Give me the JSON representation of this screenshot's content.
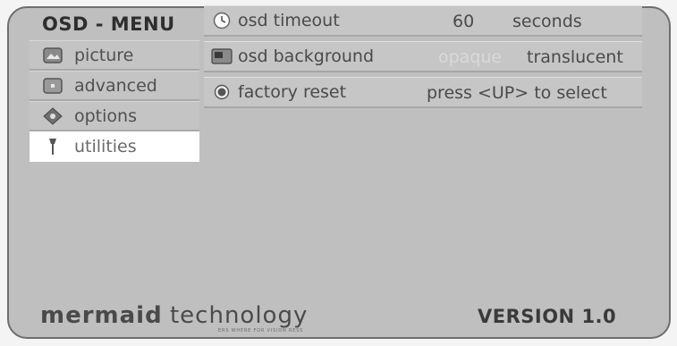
{
  "menu": {
    "title": "OSD - MENU"
  },
  "sidebar": {
    "items": [
      {
        "label": "picture",
        "icon": "picture-icon",
        "active": false
      },
      {
        "label": "advanced",
        "icon": "advanced-icon",
        "active": false
      },
      {
        "label": "options",
        "icon": "options-icon",
        "active": false
      },
      {
        "label": "utilities",
        "icon": "utilities-icon",
        "active": true
      }
    ]
  },
  "settings": {
    "rows": [
      {
        "label": "osd timeout",
        "icon": "clock-icon",
        "value": "60",
        "unit": "seconds"
      },
      {
        "label": "osd background",
        "icon": "background-icon",
        "option_off": "opaque",
        "option_on": "translucent"
      },
      {
        "label": "factory reset",
        "icon": "reset-icon",
        "hint": "press <UP> to select"
      }
    ]
  },
  "footer": {
    "brand_bold": "mermaid",
    "brand_light": "technology",
    "brand_sub": "ERS WHERE FOR VISION RESS",
    "version": "VERSION 1.0"
  },
  "colors": {
    "panel": "#bfbfbf",
    "active_item": "#ffffff",
    "text": "#4a4a4a",
    "inactive_option": "#d9d9d9"
  }
}
